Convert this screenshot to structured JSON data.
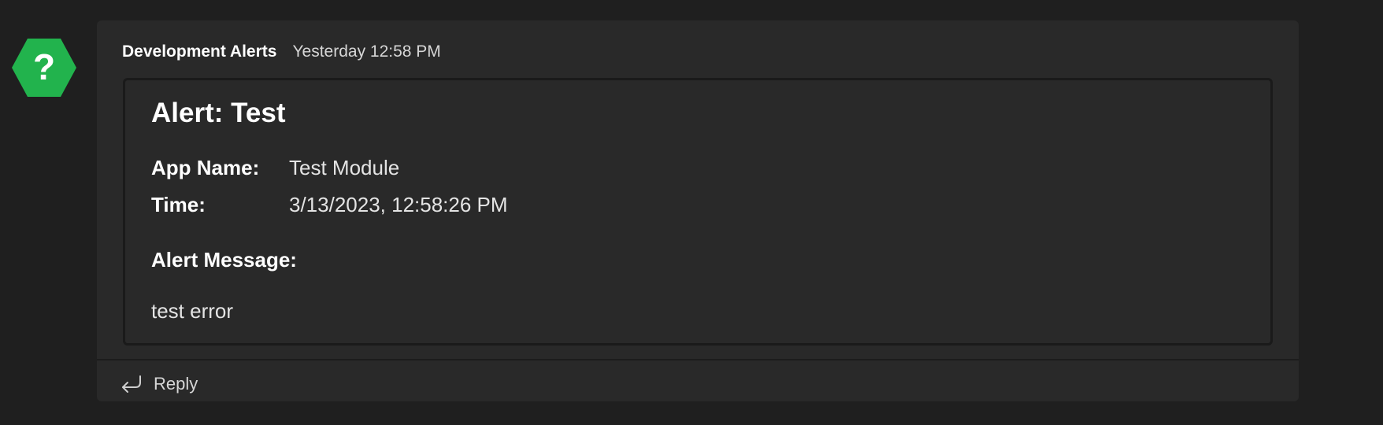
{
  "avatar": {
    "icon": "question-mark-hexagon-icon",
    "glyph": "?",
    "color": "#22b34d"
  },
  "message": {
    "sender": "Development Alerts",
    "timestamp": "Yesterday 12:58 PM"
  },
  "card": {
    "title": "Alert: Test",
    "facts": [
      {
        "key": "App Name:",
        "value": "Test Module"
      },
      {
        "key": "Time:",
        "value": "3/13/2023, 12:58:26 PM"
      }
    ],
    "message_label": "Alert Message:",
    "message_body": "test error"
  },
  "actions": {
    "reply_label": "Reply",
    "reply_icon": "reply-arrow-icon"
  },
  "colors": {
    "background": "#1f1f1f",
    "card_background": "#292929",
    "card_border": "#1a1a1a"
  }
}
